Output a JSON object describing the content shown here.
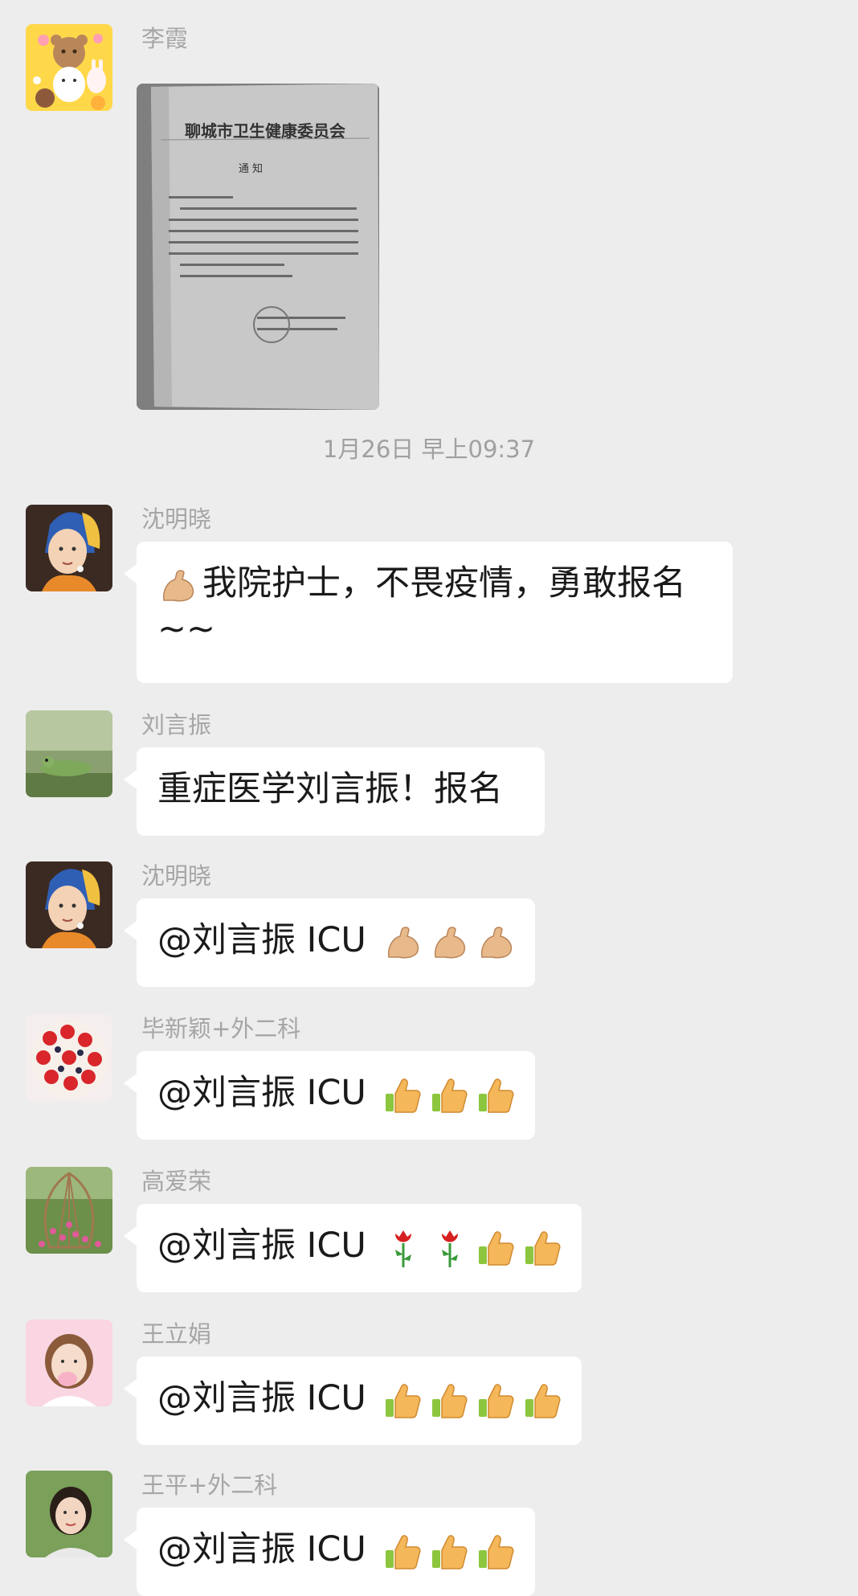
{
  "chat": {
    "first_message": {
      "sender": "李霞",
      "document": {
        "title": "聊城市卫生健康委员会",
        "subtitle": "通 知"
      }
    },
    "time_separator": "1月26日 早上09:37",
    "messages": [
      {
        "sender": "沈明晓",
        "text_line1": "我院护士，不畏疫情，勇敢报名",
        "text_line2": "~~",
        "lead_emoji": "flexed-biceps"
      },
      {
        "sender": "刘言振",
        "text": "重症医学刘言振！报名"
      },
      {
        "sender": "沈明晓",
        "text": "@刘言振 ICU",
        "emojis": [
          "flexed-biceps",
          "flexed-biceps",
          "flexed-biceps"
        ]
      },
      {
        "sender": "毕新颖+外二科",
        "text": "@刘言振 ICU",
        "emojis": [
          "thumbs-up",
          "thumbs-up",
          "thumbs-up"
        ]
      },
      {
        "sender": "高爱荣",
        "text": "@刘言振 ICU",
        "emojis": [
          "rose",
          "rose",
          "thumbs-up",
          "thumbs-up"
        ]
      },
      {
        "sender": "王立娟",
        "text": "@刘言振 ICU",
        "emojis": [
          "thumbs-up",
          "thumbs-up",
          "thumbs-up",
          "thumbs-up"
        ]
      },
      {
        "sender": "王平+外二科",
        "text": "@刘言振 ICU",
        "emojis": [
          "thumbs-up",
          "thumbs-up",
          "thumbs-up"
        ]
      }
    ]
  }
}
